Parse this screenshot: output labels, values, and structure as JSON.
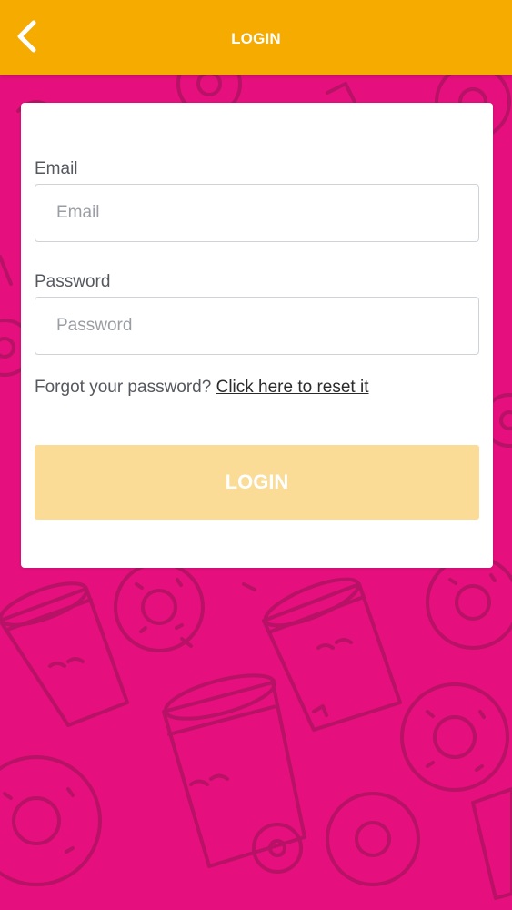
{
  "header": {
    "title": "LOGIN",
    "back_icon": "chevron-left-icon"
  },
  "form": {
    "email_label": "Email",
    "email_placeholder": "Email",
    "email_value": "",
    "password_label": "Password",
    "password_placeholder": "Password",
    "password_value": "",
    "forgot_text": "Forgot your password?",
    "reset_link_text": "Click here to reset it",
    "login_button_label": "LOGIN"
  },
  "colors": {
    "header_bg": "#f5ab00",
    "page_bg": "#e50f7d",
    "login_button_disabled_bg": "#fadc97",
    "pattern_stroke": "#a8135f"
  }
}
